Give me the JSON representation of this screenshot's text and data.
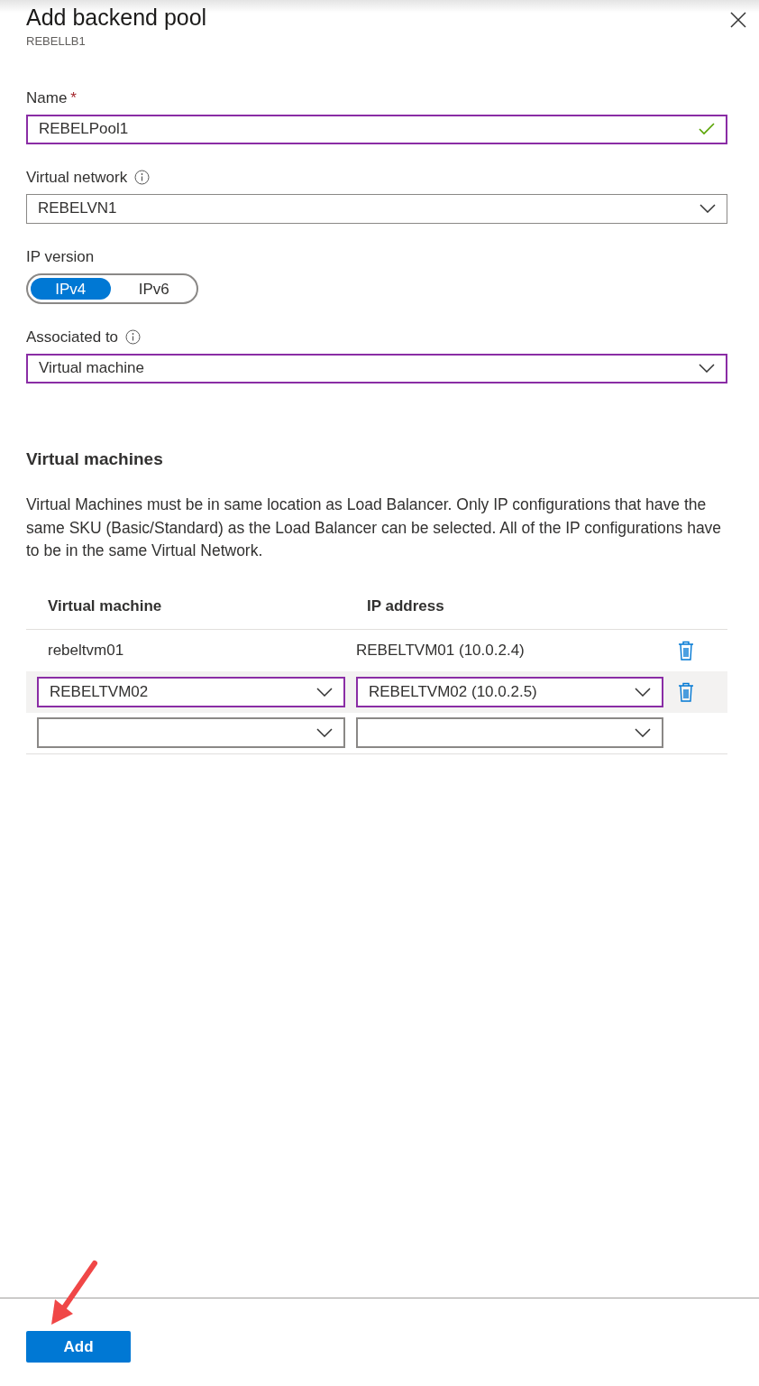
{
  "panel": {
    "title": "Add backend pool",
    "subtitle": "REBELLB1"
  },
  "fields": [
    {
      "kind": "text",
      "label": "Name",
      "required_mark": "*",
      "value": "REBELPool1",
      "focused": true,
      "valid": true
    },
    {
      "kind": "select",
      "label": "Virtual network",
      "info": true,
      "value": "REBELVN1",
      "focused": false
    },
    {
      "kind": "toggle",
      "label": "IP version",
      "options": [
        {
          "label": "IPv4",
          "selected": true
        },
        {
          "label": "IPv6",
          "selected": false
        }
      ]
    },
    {
      "kind": "select",
      "label": "Associated to",
      "info": true,
      "value": "Virtual machine",
      "focused": true
    }
  ],
  "section": {
    "title": "Virtual machines",
    "description": "Virtual Machines must be in same location as Load Balancer. Only IP configurations that have the same SKU (Basic/Standard) as the Load Balancer can be selected. All of the IP configurations have to be in the same Virtual Network."
  },
  "table": {
    "columns": [
      "Virtual machine",
      "IP address"
    ],
    "rows": [
      {
        "kind": "text",
        "selected": false,
        "deletable": true,
        "cells": [
          "rebeltvm01",
          "REBELTVM01 (10.0.2.4)"
        ]
      },
      {
        "kind": "select",
        "selected": true,
        "deletable": true,
        "cells": [
          "REBELTVM02",
          "REBELTVM02 (10.0.2.5)"
        ]
      },
      {
        "kind": "select",
        "selected": false,
        "deletable": false
      }
    ]
  },
  "footer": {
    "button": "Add"
  }
}
